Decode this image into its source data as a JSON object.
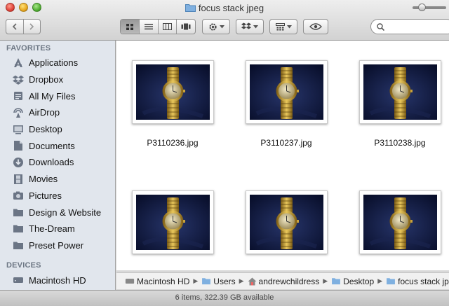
{
  "window": {
    "title": "focus stack jpeg"
  },
  "toolbar": {
    "back_icon": "chevron-left-icon",
    "forward_icon": "chevron-right-icon",
    "views": [
      "icon-view",
      "list-view",
      "column-view",
      "coverflow-view"
    ],
    "active_view": "icon-view",
    "search_placeholder": ""
  },
  "sidebar": {
    "favorites_header": "FAVORITES",
    "favorites": [
      {
        "label": "Applications",
        "icon": "applications-icon"
      },
      {
        "label": "Dropbox",
        "icon": "dropbox-icon"
      },
      {
        "label": "All My Files",
        "icon": "all-my-files-icon"
      },
      {
        "label": "AirDrop",
        "icon": "airdrop-icon"
      },
      {
        "label": "Desktop",
        "icon": "desktop-icon"
      },
      {
        "label": "Documents",
        "icon": "documents-icon"
      },
      {
        "label": "Downloads",
        "icon": "downloads-icon"
      },
      {
        "label": "Movies",
        "icon": "movies-icon"
      },
      {
        "label": "Pictures",
        "icon": "pictures-icon"
      },
      {
        "label": "Design & Website",
        "icon": "folder-icon"
      },
      {
        "label": "The-Dream",
        "icon": "folder-icon"
      },
      {
        "label": "Preset Power",
        "icon": "folder-icon"
      }
    ],
    "devices_header": "DEVICES",
    "devices": [
      {
        "label": "Macintosh HD",
        "icon": "hard-drive-icon"
      }
    ]
  },
  "files": [
    {
      "name": "P3110236.jpg"
    },
    {
      "name": "P3110237.jpg"
    },
    {
      "name": "P3110238.jpg"
    },
    {
      "name": ""
    },
    {
      "name": ""
    },
    {
      "name": ""
    }
  ],
  "pathbar": {
    "segments": [
      "Macintosh HD",
      "Users",
      "andrewchildress",
      "Desktop",
      "focus stack jpeg"
    ]
  },
  "status": {
    "text": "6 items, 322.39 GB available"
  },
  "colors": {
    "sidebar_bg": "#e1e6ed",
    "sidebar_header": "#6d7784",
    "folder_blue": "#6fa3d8"
  }
}
